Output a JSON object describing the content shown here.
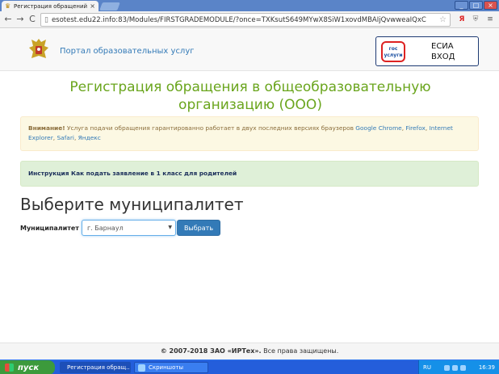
{
  "browser": {
    "tab_title": "Регистрация обращений в",
    "tab_close": "×",
    "url": "esotest.edu22.info:83/Modules/FIRSTGRADEMODULE/?once=TXKsutS649MYwX8SiW1xovdMBAIjQvwweaIQxC",
    "back": "←",
    "forward": "→",
    "reload": "C",
    "star": "☆",
    "window_controls": [
      "_",
      "□",
      "×"
    ]
  },
  "header": {
    "portal_title": "Портал образовательных услуг",
    "gos_logo_text": "гос услуги",
    "esia_line1": "ЕСИА",
    "esia_line2": "ВХОД"
  },
  "main": {
    "heading": "Регистрация обращения в общеобразовательную организацию (ООО)",
    "warning": {
      "strong": "Внимание!",
      "text": " Услуга подачи обращения гарантированно работает в двух последних версиях браузеров ",
      "chrome": "Google Chrome",
      "sep1": ", ",
      "firefox": "Firefox",
      "sep2": ", ",
      "ie": "Internet Explorer",
      "sep3": ", ",
      "safari": "Safari",
      "sep4": ", ",
      "yandex": "Яндекс"
    },
    "instruction": "Инструкция Как подать заявление в 1 класс для родителей",
    "section_title": "Выберите муниципалитет",
    "form": {
      "label": "Муниципалитет",
      "selected": "г. Барнаул",
      "submit": "Выбрать"
    }
  },
  "footer": {
    "copyright_bold": "© 2007-2018 ЗАО «ИРТех».",
    "rest": " Все права защищены."
  },
  "taskbar": {
    "start": "пуск",
    "task1": "Регистрация обращ...",
    "task2": "Скриншоты",
    "lang": "RU",
    "clock": "16:39"
  }
}
